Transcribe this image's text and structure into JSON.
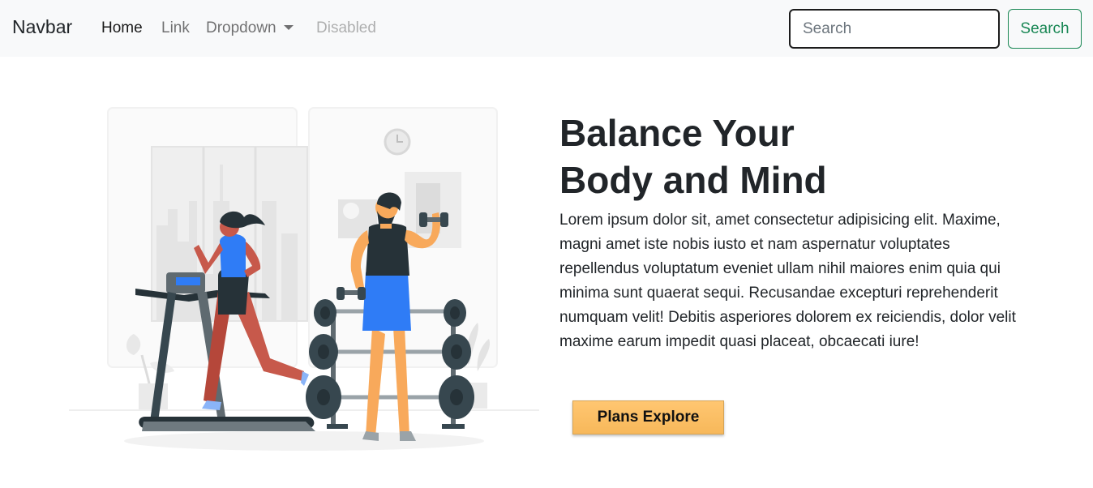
{
  "navbar": {
    "brand": "Navbar",
    "links": [
      {
        "label": "Home"
      },
      {
        "label": "Link"
      },
      {
        "label": "Dropdown"
      },
      {
        "label": "Disabled"
      }
    ],
    "search": {
      "placeholder": "Search",
      "button_label": "Search"
    }
  },
  "hero": {
    "title_line1": "Balance Your",
    "title_line2": "Body and Mind",
    "text": "Lorem ipsum dolor sit, amet consectetur adipisicing elit. Maxime, magni amet iste nobis iusto et nam aspernatur voluptates repellendus voluptatum eveniet ullam nihil maiores enim quia qui minima sunt quaerat sequi. Recusandae excepturi reprehenderit numquam velit! Debitis asperiores dolorem ex reiciendis, dolor velit maxime earum impedit quasi placeat, obcaecati iure!",
    "cta_label": "Plans Explore"
  },
  "colors": {
    "navbar_bg": "#f8f9fa",
    "search_outline": "#198754",
    "cta_bg": "#ffc671",
    "accent_blue": "#2f7cf6",
    "skin_orange": "#f8a95b"
  }
}
